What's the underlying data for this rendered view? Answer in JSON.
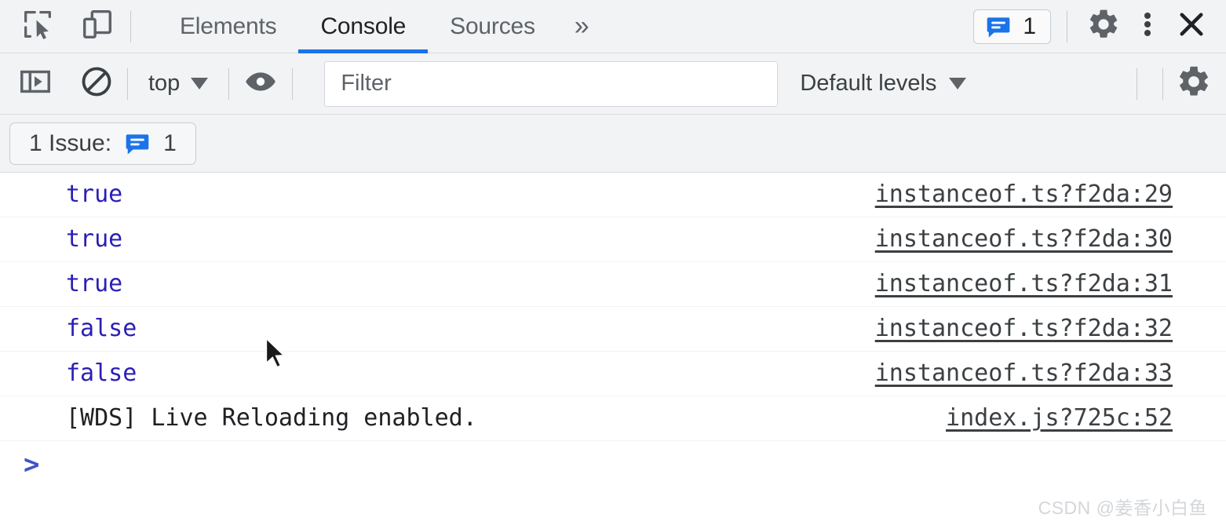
{
  "tabbar": {
    "inspect_icon": "inspect-element-icon",
    "device_icon": "device-toolbar-icon",
    "tabs": [
      {
        "label": "Elements",
        "active": false
      },
      {
        "label": "Console",
        "active": true
      },
      {
        "label": "Sources",
        "active": false
      }
    ],
    "more_tabs_label": "»",
    "issues_badge": {
      "icon": "issues-bubble-icon",
      "count": "1"
    },
    "settings_icon": "gear-icon",
    "more_options_icon": "three-dot-menu-icon",
    "close_icon": "close-icon",
    "accent_color": "#1a73e8"
  },
  "console_toolbar": {
    "sidebar_toggle_icon": "console-sidebar-toggle-icon",
    "clear_icon": "clear-console-icon",
    "context": {
      "label": "top",
      "caret": "▼"
    },
    "live_expression_icon": "eye-icon",
    "filter": {
      "value": "",
      "placeholder": "Filter"
    },
    "levels": {
      "label": "Default levels",
      "caret": "▼"
    },
    "settings_icon": "gear-icon"
  },
  "issues_bar": {
    "label": "1 Issue:",
    "icon": "issues-bubble-icon",
    "count": "1"
  },
  "console": {
    "messages": [
      {
        "text": "true",
        "kind": "boolean",
        "source": "instanceof.ts?f2da:29"
      },
      {
        "text": "true",
        "kind": "boolean",
        "source": "instanceof.ts?f2da:30"
      },
      {
        "text": "true",
        "kind": "boolean",
        "source": "instanceof.ts?f2da:31"
      },
      {
        "text": "false",
        "kind": "boolean",
        "source": "instanceof.ts?f2da:32"
      },
      {
        "text": "false",
        "kind": "boolean",
        "source": "instanceof.ts?f2da:33"
      },
      {
        "text": "[WDS] Live Reloading enabled.",
        "kind": "plain",
        "source": "index.js?725c:52"
      }
    ],
    "prompt": {
      "chevron": ">",
      "value": ""
    },
    "boolean_color": "#2a1fb5",
    "link_color": "#3c4043"
  },
  "watermark": {
    "text": "CSDN @姜香小白鱼"
  }
}
